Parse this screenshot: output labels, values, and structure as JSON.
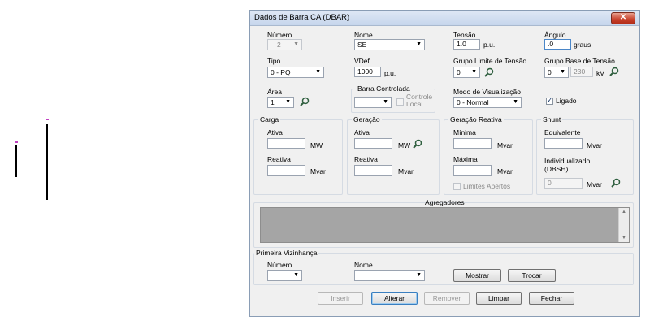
{
  "window": {
    "title": "Dados de Barra CA (DBAR)",
    "close_symbol": "✕"
  },
  "fields": {
    "numero_label": "Número",
    "numero_value": "2",
    "nome_label": "Nome",
    "nome_value": "SE",
    "tensao_label": "Tensão",
    "tensao_value": "1.0",
    "tensao_unit": "p.u.",
    "angulo_label": "Ângulo",
    "angulo_value": ".0",
    "angulo_unit": "graus",
    "tipo_label": "Tipo",
    "tipo_value": "0 - PQ",
    "vdef_label": "VDef",
    "vdef_value": "1000",
    "vdef_unit": "p.u.",
    "grupo_limite_label": "Grupo Limite de Tensão",
    "grupo_limite_value": "0",
    "grupo_base_label": "Grupo Base de Tensão",
    "grupo_base_value": "0",
    "grupo_base_kv": "230",
    "grupo_base_unit": "kV",
    "area_label": "Área",
    "area_value": "1",
    "barra_controlada_label": "Barra Controlada",
    "barra_controlada_value": "",
    "controle_local_label": "Controle Local",
    "modo_label": "Modo de Visualização",
    "modo_value": "0 - Normal",
    "ligado_label": "Ligado"
  },
  "carga": {
    "title": "Carga",
    "ativa_label": "Ativa",
    "ativa_value": "",
    "ativa_unit": "MW",
    "reativa_label": "Reativa",
    "reativa_value": "",
    "reativa_unit": "Mvar"
  },
  "geracao": {
    "title": "Geração",
    "ativa_label": "Ativa",
    "ativa_value": "",
    "ativa_unit": "MW",
    "reativa_label": "Reativa",
    "reativa_value": "",
    "reativa_unit": "Mvar"
  },
  "geracao_reativa": {
    "title": "Geração Reativa",
    "minima_label": "Mínima",
    "minima_value": "",
    "minima_unit": "Mvar",
    "maxima_label": "Máxima",
    "maxima_value": "",
    "maxima_unit": "Mvar",
    "limites_label": "Limites Abertos"
  },
  "shunt": {
    "title": "Shunt",
    "equivalente_label": "Equivalente",
    "equivalente_value": "",
    "equivalente_unit": "Mvar",
    "individualizado_label": "Individualizado (DBSH)",
    "individualizado_value": "0",
    "individualizado_unit": "Mvar"
  },
  "agregadores": {
    "title": "Agregadores"
  },
  "vizinhanca": {
    "title": "Primeira Vizinhança",
    "numero_label": "Número",
    "nome_label": "Nome",
    "numero_value": "",
    "nome_value": "",
    "mostrar_label": "Mostrar",
    "trocar_label": "Trocar"
  },
  "buttons": {
    "inserir": "Inserir",
    "alterar": "Alterar",
    "remover": "Remover",
    "limpar": "Limpar",
    "fechar": "Fechar"
  },
  "colors": {
    "bus_marker": "#c040c0",
    "title_gradient": "#c6d6ec",
    "close_red": "#c8412b"
  }
}
